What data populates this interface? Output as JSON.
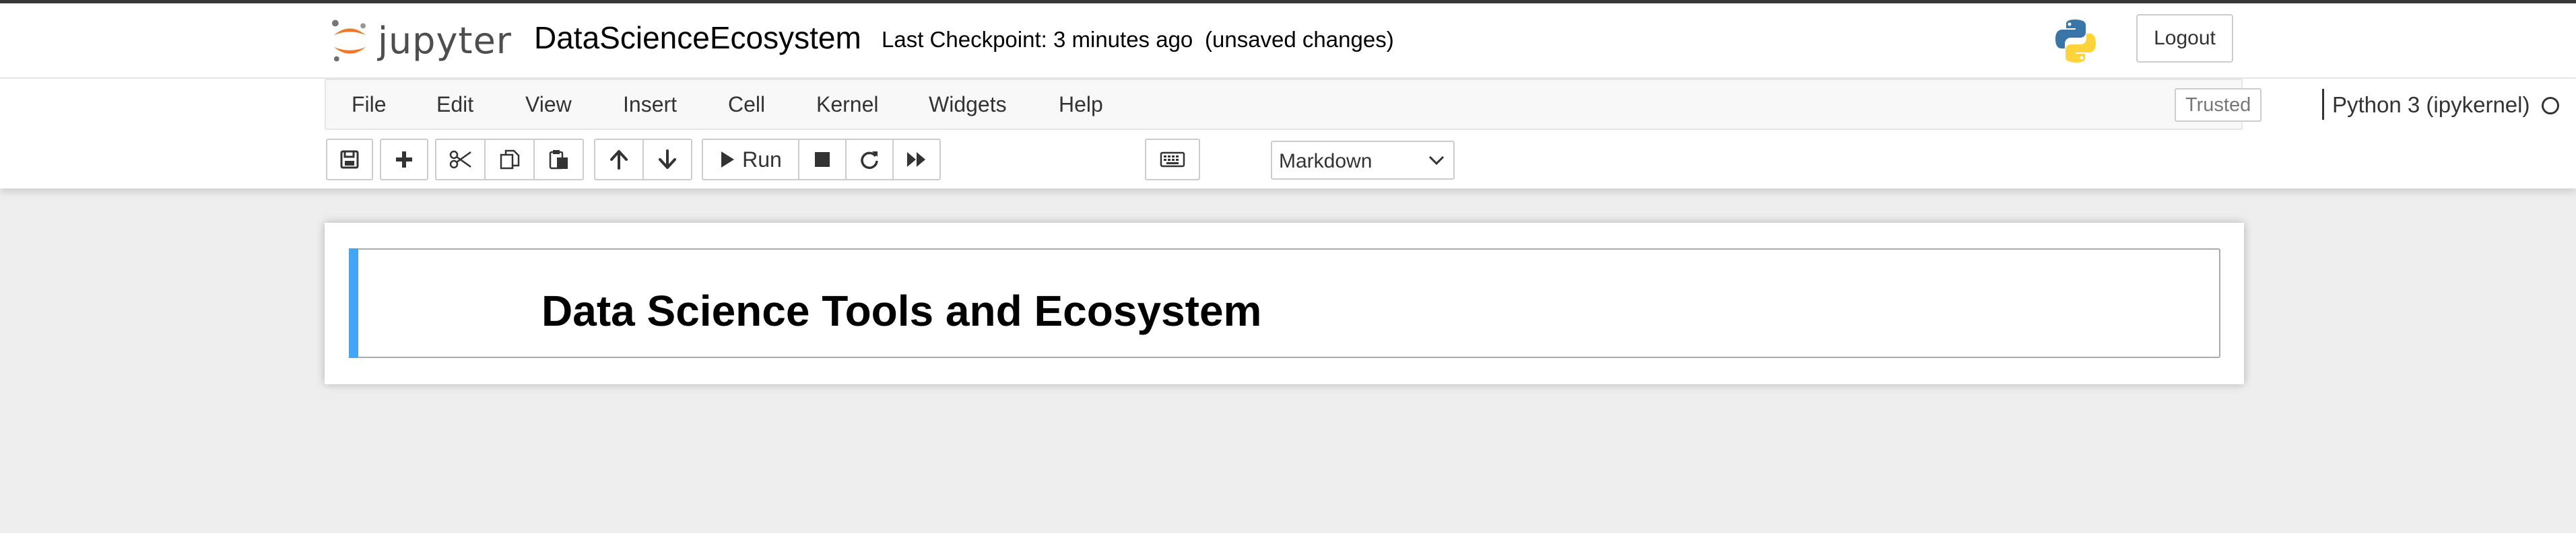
{
  "header": {
    "logo_text": "jupyter",
    "notebook_name": "DataScienceEcosystem",
    "checkpoint": "Last Checkpoint: 3 minutes ago",
    "save_status": "(unsaved changes)",
    "logout_label": "Logout",
    "brand_orange": "#f37726"
  },
  "menubar": {
    "items": [
      "File",
      "Edit",
      "View",
      "Insert",
      "Cell",
      "Kernel",
      "Widgets",
      "Help"
    ],
    "trusted_label": "Trusted",
    "kernel_name": "Python 3 (ipykernel)",
    "kernel_status_icon": "circle-outline-icon"
  },
  "toolbar": {
    "buttons": [
      "save-icon",
      "plus-icon",
      "cut-icon",
      "copy-icon",
      "paste-icon",
      "arrow-up-icon",
      "arrow-down-icon",
      "play-icon",
      "stop-icon",
      "restart-icon",
      "fast-forward-icon",
      "keyboard-icon"
    ],
    "run_label": "Run",
    "cell_type": "Markdown"
  },
  "notebook": {
    "cells": [
      {
        "type": "markdown",
        "rendered_heading": "Data Science Tools and Ecosystem",
        "accent": "#42a5f5"
      }
    ]
  }
}
